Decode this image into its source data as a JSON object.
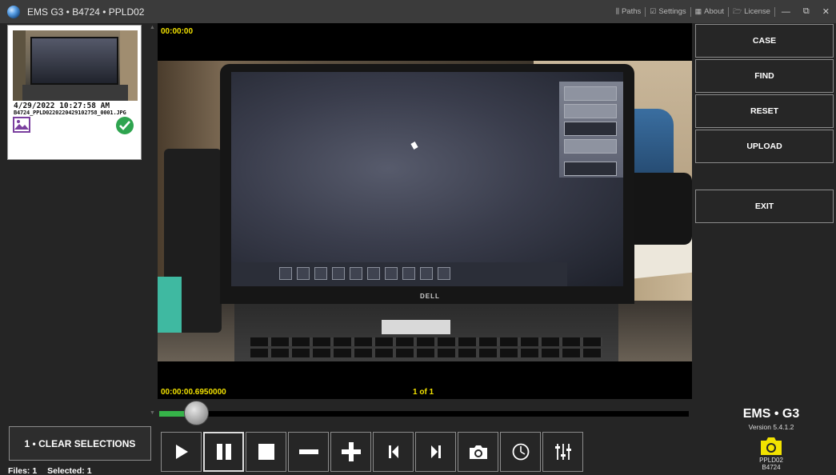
{
  "window": {
    "title": "EMS G3 • B4724 • PPLD02",
    "menu": [
      {
        "icon": "folder-paths-icon",
        "glyph": "⫼",
        "label": "Paths"
      },
      {
        "icon": "settings-check-icon",
        "glyph": "☑",
        "label": "Settings"
      },
      {
        "icon": "about-icon",
        "glyph": "▦",
        "label": "About"
      },
      {
        "icon": "folder-open-icon",
        "glyph": "🗁",
        "label": "License"
      }
    ]
  },
  "thumbnail": {
    "date": "4/29/2022 10:27:58 AM",
    "filename": "B4724_PPLD0220220429102758_0001.JPG"
  },
  "viewer": {
    "timecode_top": "00:00:00",
    "timecode_bottom": "00:00:00.6950000",
    "page": "1 of 1",
    "progress": 0.07,
    "laptop_brand": "DELL"
  },
  "sidebar": {
    "clear_label": "1 • CLEAR SELECTIONS",
    "files_label": "Files: 1",
    "selected_label": "Selected: 1"
  },
  "actions": {
    "case": "CASE",
    "find": "FIND",
    "reset": "RESET",
    "upload": "UPLOAD",
    "exit": "EXIT"
  },
  "controls": [
    "play-icon",
    "pause-icon",
    "stop-icon",
    "minus-icon",
    "plus-icon",
    "previous-icon",
    "next-icon",
    "camera-icon",
    "timer-icon",
    "equalizer-icon"
  ],
  "brand": {
    "name": "EMS • G3",
    "version": "Version 5.4.1.2",
    "device": "PPLD02",
    "unit": "B4724"
  },
  "colors": {
    "accent_yellow": "#f2e200",
    "progress_green": "#36b349",
    "check_green": "#2ea44f",
    "image_icon_purple": "#7a3f9e"
  }
}
